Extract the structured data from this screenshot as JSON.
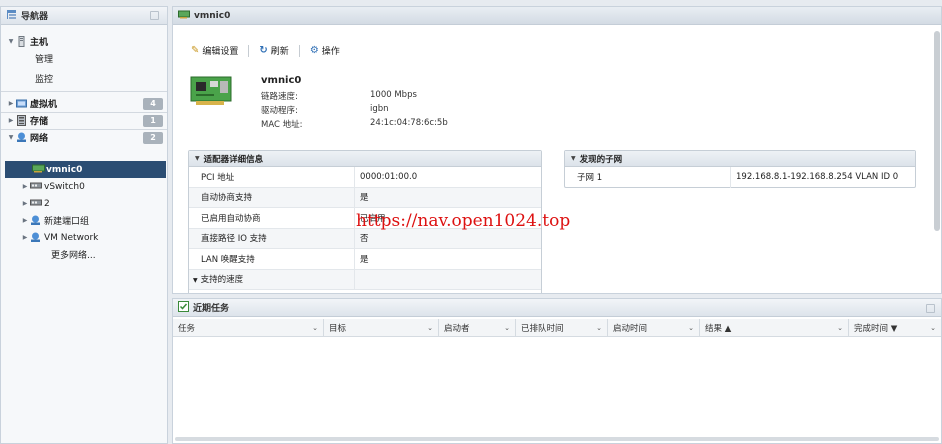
{
  "navigator": {
    "title": "导航器",
    "host": {
      "label": "主机",
      "children": [
        "管理",
        "监控"
      ]
    },
    "items": [
      {
        "label": "虚拟机",
        "count": "4"
      },
      {
        "label": "存储",
        "count": "1"
      },
      {
        "label": "网络",
        "count": "2"
      }
    ],
    "network_children": [
      "vmnic0",
      "vSwitch0",
      "2",
      "新建端口组",
      "VM Network",
      "更多网络..."
    ]
  },
  "main": {
    "title": "vmnic0",
    "toolbar": {
      "edit": "编辑设置",
      "refresh": "刷新",
      "actions": "操作"
    },
    "nic": {
      "name": "vmnic0",
      "props": [
        {
          "label": "链路速度:",
          "value": "1000 Mbps"
        },
        {
          "label": "驱动程序:",
          "value": "igbn"
        },
        {
          "label": "MAC 地址:",
          "value": "24:1c:04:78:6c:5b"
        }
      ]
    },
    "adapter": {
      "title": "适配器详细信息",
      "rows": [
        {
          "key": "PCI 地址",
          "value": "0000:01:00.0"
        },
        {
          "key": "自动协商支持",
          "value": "是"
        },
        {
          "key": "已启用自动协商",
          "value": "已启用"
        },
        {
          "key": "直接路径 IO 支持",
          "value": "否"
        },
        {
          "key": "LAN 唤醒支持",
          "value": "是"
        },
        {
          "key": "支持的速度",
          "value": ""
        }
      ]
    },
    "subnets": {
      "title": "发现的子网",
      "rows": [
        {
          "key": "子网 1",
          "value": "192.168.8.1-192.168.8.254 VLAN ID 0"
        }
      ]
    }
  },
  "tasks": {
    "title": "近期任务",
    "columns": [
      "任务",
      "目标",
      "启动者",
      "已排队时间",
      "启动时间",
      "结果 ▲",
      "完成时间 ▼"
    ]
  },
  "watermark": "https://nav.open1024.top",
  "colors": {
    "selected": "#2b4d73",
    "badge": "#a9b2bb",
    "watermark": "#dd1111"
  }
}
